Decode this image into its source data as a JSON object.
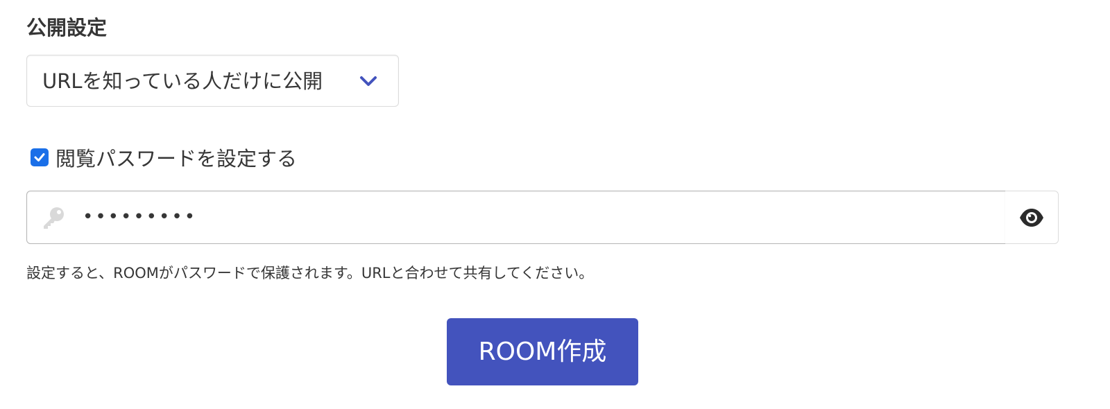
{
  "visibility": {
    "label": "公開設定",
    "selected_option": "URLを知っている人だけに公開",
    "chevron_icon": "chevron-down-icon",
    "accent_color": "#4353bd"
  },
  "password": {
    "checkbox_label": "閲覧パスワードを設定する",
    "checked": true,
    "checkbox_color": "#1a6fe8",
    "value": "•••••••••",
    "leading_icon": "key-icon",
    "toggle_icon": "eye-icon",
    "help_text": "設定すると、ROOMがパスワードで保護されます。URLと合わせて共有してください。"
  },
  "submit": {
    "label": "ROOM作成",
    "color": "#4353bd"
  }
}
